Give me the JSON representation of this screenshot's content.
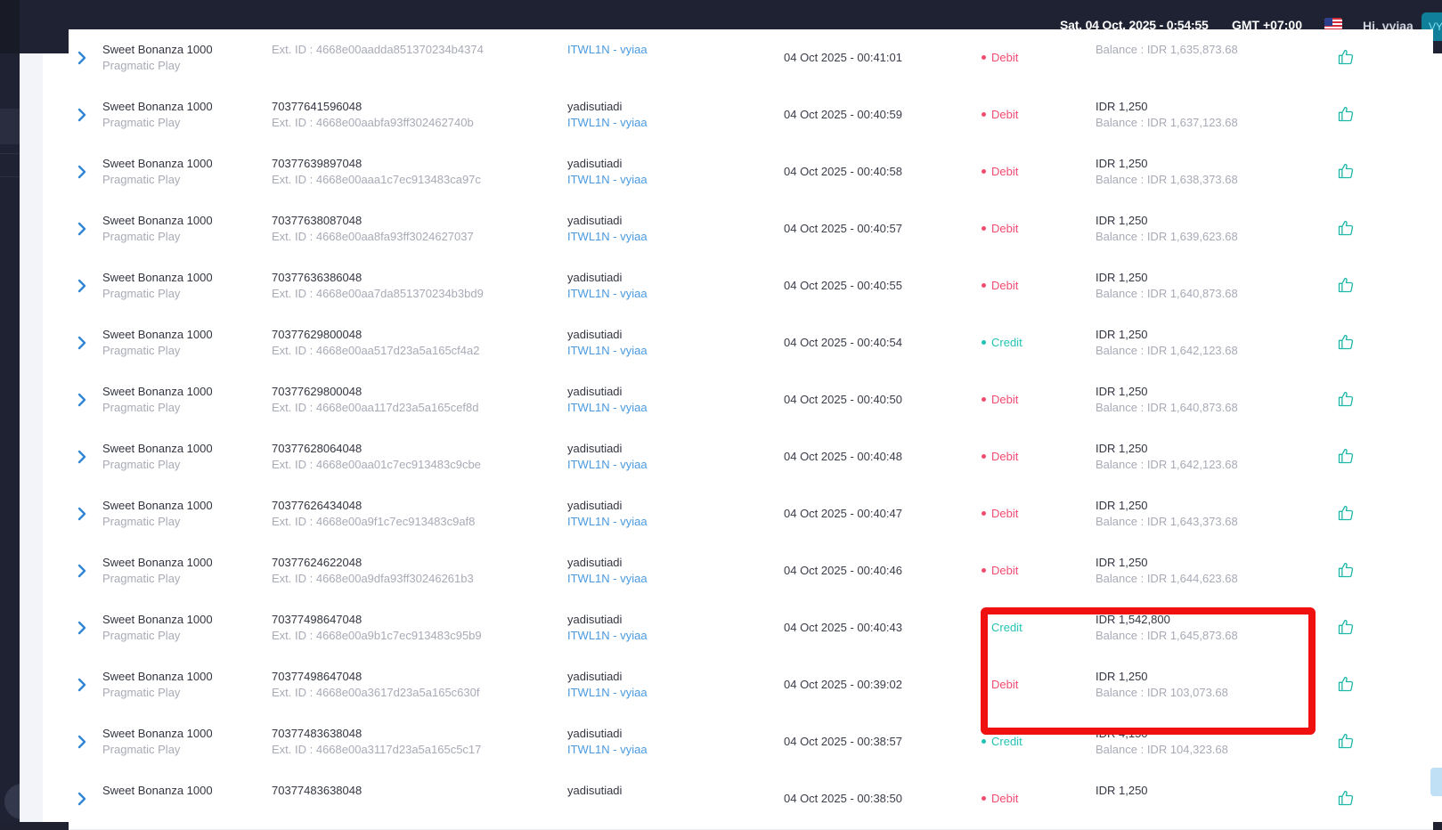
{
  "header": {
    "datetime": "Sat, 04 Oct, 2025 - 0:54:55",
    "timezone": "GMT +07:00",
    "greeting": "Hi, vyiaa",
    "avatar_initials": "VY",
    "flag_icon": "us-flag-icon"
  },
  "colors": {
    "debit": "#f44b6f",
    "credit": "#22c3b4",
    "link": "#4a9ae0",
    "highlight_box": "#f01010",
    "topbar": "#1f2232"
  },
  "rows": [
    {
      "game": "Sweet Bonanza 1000",
      "provider": "Pragmatic Play",
      "txn_id": "",
      "ext_id": "Ext. ID : 4668e00aadda851370234b4374",
      "player": "",
      "agent": "ITWL1N - vyiaa",
      "datetime": "04 Oct 2025 - 00:41:01",
      "type": "Debit",
      "amount": "",
      "balance": "Balance : IDR 1,635,873.68"
    },
    {
      "game": "Sweet Bonanza 1000",
      "provider": "Pragmatic Play",
      "txn_id": "70377641596048",
      "ext_id": "Ext. ID : 4668e00aabfa93ff302462740b",
      "player": "yadisutiadi",
      "agent": "ITWL1N - vyiaa",
      "datetime": "04 Oct 2025 - 00:40:59",
      "type": "Debit",
      "amount": "IDR 1,250",
      "balance": "Balance : IDR 1,637,123.68"
    },
    {
      "game": "Sweet Bonanza 1000",
      "provider": "Pragmatic Play",
      "txn_id": "70377639897048",
      "ext_id": "Ext. ID : 4668e00aaa1c7ec913483ca97c",
      "player": "yadisutiadi",
      "agent": "ITWL1N - vyiaa",
      "datetime": "04 Oct 2025 - 00:40:58",
      "type": "Debit",
      "amount": "IDR 1,250",
      "balance": "Balance : IDR 1,638,373.68"
    },
    {
      "game": "Sweet Bonanza 1000",
      "provider": "Pragmatic Play",
      "txn_id": "70377638087048",
      "ext_id": "Ext. ID : 4668e00aa8fa93ff3024627037",
      "player": "yadisutiadi",
      "agent": "ITWL1N - vyiaa",
      "datetime": "04 Oct 2025 - 00:40:57",
      "type": "Debit",
      "amount": "IDR 1,250",
      "balance": "Balance : IDR 1,639,623.68"
    },
    {
      "game": "Sweet Bonanza 1000",
      "provider": "Pragmatic Play",
      "txn_id": "70377636386048",
      "ext_id": "Ext. ID : 4668e00aa7da851370234b3bd9",
      "player": "yadisutiadi",
      "agent": "ITWL1N - vyiaa",
      "datetime": "04 Oct 2025 - 00:40:55",
      "type": "Debit",
      "amount": "IDR 1,250",
      "balance": "Balance : IDR 1,640,873.68"
    },
    {
      "game": "Sweet Bonanza 1000",
      "provider": "Pragmatic Play",
      "txn_id": "70377629800048",
      "ext_id": "Ext. ID : 4668e00aa517d23a5a165cf4a2",
      "player": "yadisutiadi",
      "agent": "ITWL1N - vyiaa",
      "datetime": "04 Oct 2025 - 00:40:54",
      "type": "Credit",
      "amount": "IDR 1,250",
      "balance": "Balance : IDR 1,642,123.68"
    },
    {
      "game": "Sweet Bonanza 1000",
      "provider": "Pragmatic Play",
      "txn_id": "70377629800048",
      "ext_id": "Ext. ID : 4668e00aa117d23a5a165cef8d",
      "player": "yadisutiadi",
      "agent": "ITWL1N - vyiaa",
      "datetime": "04 Oct 2025 - 00:40:50",
      "type": "Debit",
      "amount": "IDR 1,250",
      "balance": "Balance : IDR 1,640,873.68"
    },
    {
      "game": "Sweet Bonanza 1000",
      "provider": "Pragmatic Play",
      "txn_id": "70377628064048",
      "ext_id": "Ext. ID : 4668e00aa01c7ec913483c9cbe",
      "player": "yadisutiadi",
      "agent": "ITWL1N - vyiaa",
      "datetime": "04 Oct 2025 - 00:40:48",
      "type": "Debit",
      "amount": "IDR 1,250",
      "balance": "Balance : IDR 1,642,123.68"
    },
    {
      "game": "Sweet Bonanza 1000",
      "provider": "Pragmatic Play",
      "txn_id": "70377626434048",
      "ext_id": "Ext. ID : 4668e00a9f1c7ec913483c9af8",
      "player": "yadisutiadi",
      "agent": "ITWL1N - vyiaa",
      "datetime": "04 Oct 2025 - 00:40:47",
      "type": "Debit",
      "amount": "IDR 1,250",
      "balance": "Balance : IDR 1,643,373.68"
    },
    {
      "game": "Sweet Bonanza 1000",
      "provider": "Pragmatic Play",
      "txn_id": "70377624622048",
      "ext_id": "Ext. ID : 4668e00a9dfa93ff30246261b3",
      "player": "yadisutiadi",
      "agent": "ITWL1N - vyiaa",
      "datetime": "04 Oct 2025 - 00:40:46",
      "type": "Debit",
      "amount": "IDR 1,250",
      "balance": "Balance : IDR 1,644,623.68"
    },
    {
      "game": "Sweet Bonanza 1000",
      "provider": "Pragmatic Play",
      "txn_id": "70377498647048",
      "ext_id": "Ext. ID : 4668e00a9b1c7ec913483c95b9",
      "player": "yadisutiadi",
      "agent": "ITWL1N - vyiaa",
      "datetime": "04 Oct 2025 - 00:40:43",
      "type": "Credit",
      "amount": "IDR 1,542,800",
      "balance": "Balance : IDR 1,645,873.68"
    },
    {
      "game": "Sweet Bonanza 1000",
      "provider": "Pragmatic Play",
      "txn_id": "70377498647048",
      "ext_id": "Ext. ID : 4668e00a3617d23a5a165c630f",
      "player": "yadisutiadi",
      "agent": "ITWL1N - vyiaa",
      "datetime": "04 Oct 2025 - 00:39:02",
      "type": "Debit",
      "amount": "IDR 1,250",
      "balance": "Balance : IDR 103,073.68"
    },
    {
      "game": "Sweet Bonanza 1000",
      "provider": "Pragmatic Play",
      "txn_id": "70377483638048",
      "ext_id": "Ext. ID : 4668e00a3117d23a5a165c5c17",
      "player": "yadisutiadi",
      "agent": "ITWL1N - vyiaa",
      "datetime": "04 Oct 2025 - 00:38:57",
      "type": "Credit",
      "amount": "IDR 4,150",
      "balance": "Balance : IDR 104,323.68"
    },
    {
      "game": "Sweet Bonanza 1000",
      "provider": "",
      "txn_id": "70377483638048",
      "ext_id": "",
      "player": "yadisutiadi",
      "agent": "",
      "datetime": "04 Oct 2025 - 00:38:50",
      "type": "Debit",
      "amount": "IDR 1,250",
      "balance": ""
    }
  ]
}
